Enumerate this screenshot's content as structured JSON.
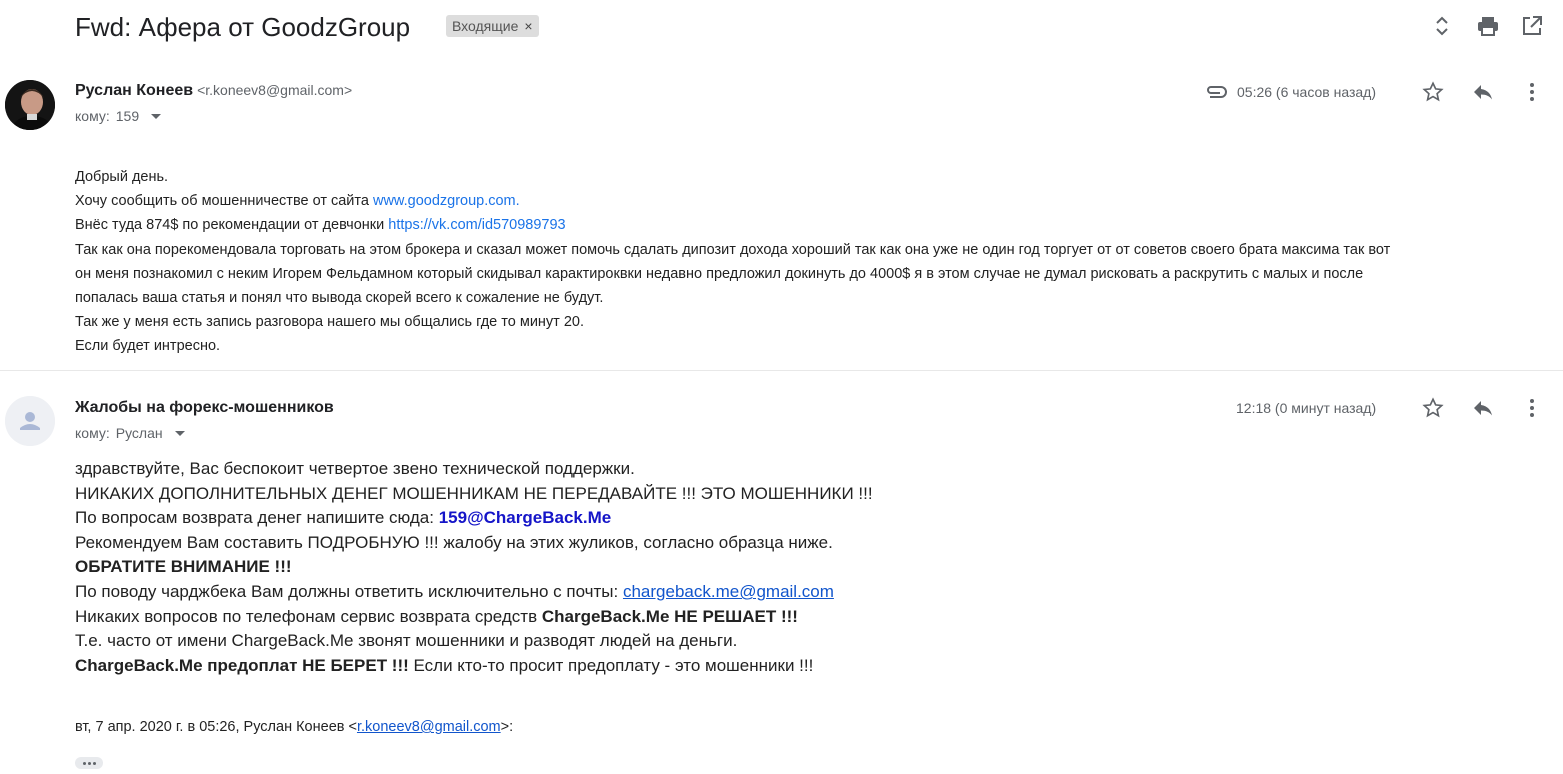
{
  "thread": {
    "subject": "Fwd: Афера от GoodzGroup",
    "label": "Входящие",
    "label_remove": "×"
  },
  "messages": [
    {
      "sender_name": "Руслан Конеев",
      "sender_email": "<r.koneev8@gmail.com>",
      "to_prefix": "кому:",
      "to": "159",
      "time": "05:26 (6 часов назад)",
      "has_attachment": true,
      "body": {
        "line1": "Добрый день.",
        "line2_text": "Хочу сообщить об мошенничестве от сайта ",
        "line2_link": "www.goodzgroup.com.",
        "line3_text": "Внёс туда 874$ по рекомендации от девчонки ",
        "line3_link": "https://vk.com/id570989793",
        "line4": "Так как она порекомендовала торговать на этом брокера и сказал может помочь сдалать дипозит дохода хороший так как она уже не один год торгует от от советов своего брата максима так вот",
        "line5": "он меня познакомил с неким Игорем Фельдамном который скидывал карактироквки недавно предложил докинуть до 4000$ я в этом случае не думал рисковать а раскрутить с малых и после",
        "line6": "попалась ваша статья и понял что вывода скорей всего к сожаление не будут.",
        "line7": "Так же у меня есть запись разговора нашего мы общались где то минут 20.",
        "line8": "Если будет интресно."
      }
    },
    {
      "sender_name": "Жалобы на форекс-мошенников",
      "to_prefix": "кому:",
      "to": "Руслан",
      "time": "12:18 (0 минут назад)",
      "body": {
        "l1": "здравствуйте, Вас беспокоит четвертое звено технической поддержки.",
        "l2": "НИКАКИХ ДОПОЛНИТЕЛЬНЫХ ДЕНЕГ МОШЕННИКАМ НЕ ПЕРЕДАВАЙТЕ !!! ЭТО МОШЕННИКИ !!!",
        "l3_text": "По вопросам возврата денег напишите сюда: ",
        "l3_bold": "159@ChargeBack.Me",
        "l4": "Рекомендуем Вам составить ПОДРОБНУЮ !!! жалобу на этих жуликов, согласно образца ниже.",
        "l5": "ОБРАТИТЕ ВНИМАНИЕ !!!",
        "l6_text": "По поводу чарджбека Вам должны ответить исключительно с почты: ",
        "l6_link": "chargeback.me@gmail.com",
        "l7_text": "Никаких вопросов по телефонам сервис возврата средств ",
        "l7_bold": "ChargeBack.Me НЕ РЕШАЕТ !!!",
        "l8": "Т.е. часто от имени ChargeBack.Me звонят мошенники и разводят людей на деньги.",
        "l9_bold": "ChargeBack.Me предоплат НЕ БЕРЕТ !!!",
        "l9_text": " Если кто-то просит предоплату - это мошенники !!!"
      },
      "quote": {
        "prefix": "вт, 7 апр. 2020 г. в 05:26, Руслан Конеев <",
        "email": "r.koneev8@gmail.com",
        "suffix": ">:"
      }
    }
  ],
  "icons": {
    "expand": "unfold-icon",
    "print": "print-icon",
    "open_new": "open-in-new-icon",
    "attachment": "paperclip-icon",
    "star": "star-icon",
    "reply": "reply-icon",
    "more": "more-vert-icon"
  },
  "colors": {
    "link": "#1a73e8",
    "link_underlined": "#1155cc",
    "bold_blue": "#1515c8",
    "chip_bg": "#dddddd",
    "muted": "#5f6368"
  }
}
